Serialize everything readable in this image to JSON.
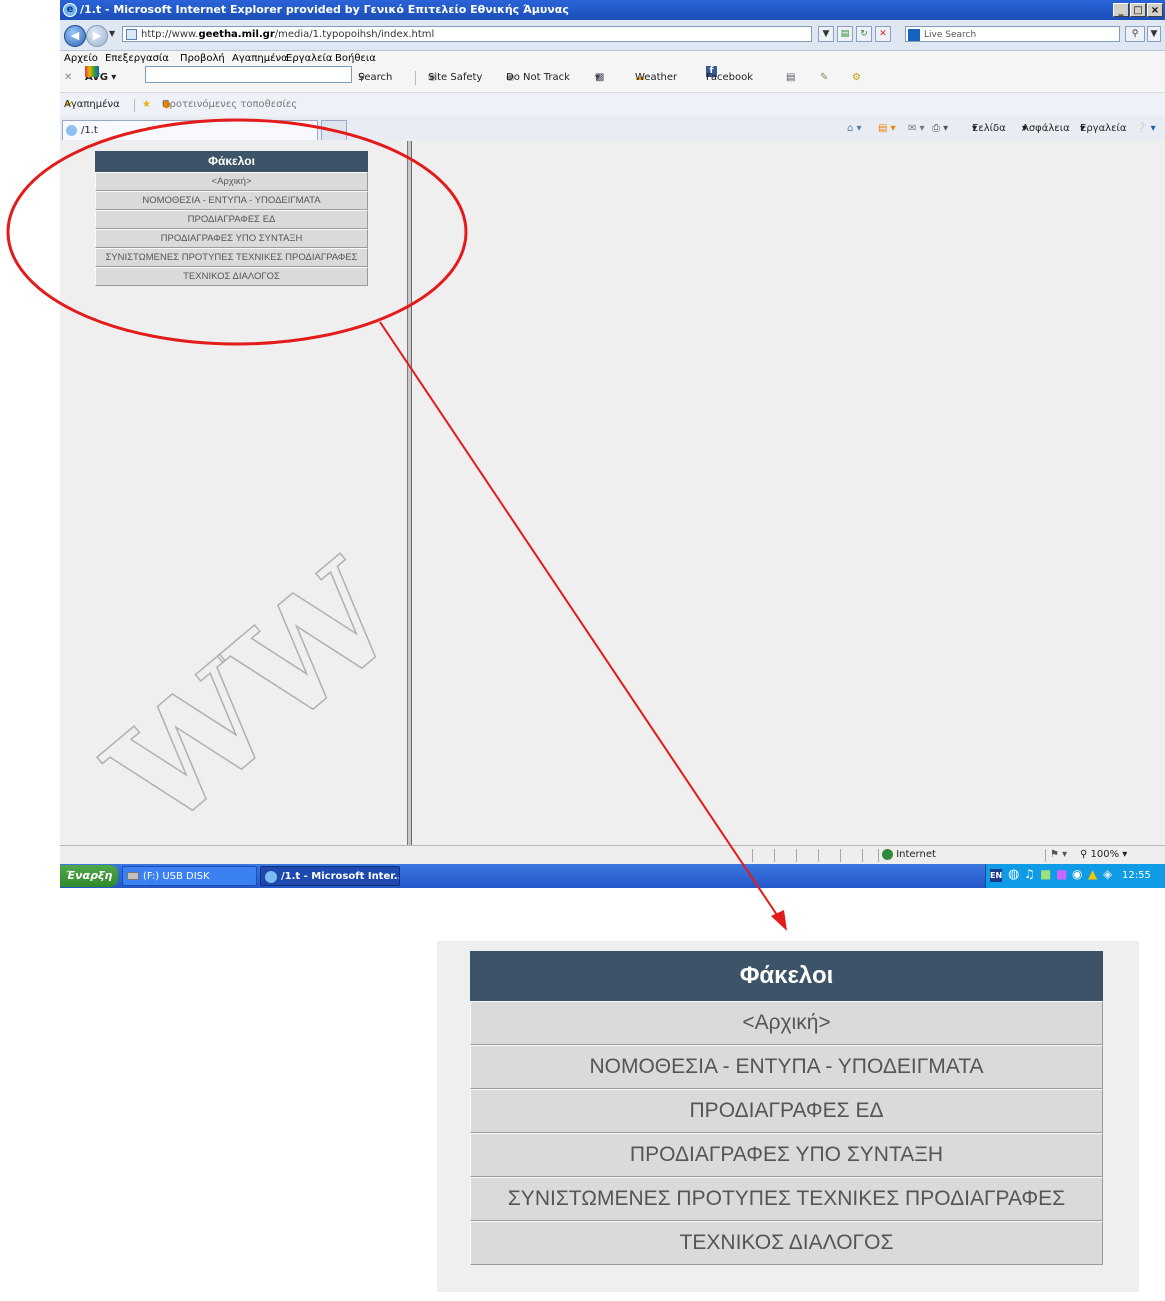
{
  "window": {
    "title": "/1.t - Microsoft Internet Explorer provided by Γενικό Επιτελείο Εθνικής Άμυνας",
    "buttons": [
      "_",
      "□",
      "×"
    ]
  },
  "address_bar": {
    "url_prefix": "http://www.",
    "url_domain": "geetha.mil.gr",
    "url_path": "/media/1.typopoihsh/index.html",
    "search_placeholder": "Live Search"
  },
  "menu": [
    "Αρχείο",
    "Επεξεργασία",
    "Προβολή",
    "Αγαπημένα",
    "Εργαλεία",
    "Βοήθεια"
  ],
  "avg_toolbar": {
    "brand": "AVG",
    "search_label": "Search",
    "items": [
      "Site Safety",
      "Do Not Track",
      "Weather",
      "Facebook"
    ]
  },
  "favorites_bar": {
    "favorites": "Αγαπημένα",
    "suggested": "Προτεινόμενες τοποθεσίες"
  },
  "tab": {
    "label": "/1.t"
  },
  "command_bar": [
    "Σελίδα",
    "Ασφάλεια",
    "Εργαλεία"
  ],
  "folders": {
    "header": "Φάκελοι",
    "items": [
      "<Αρχική>",
      "ΝΟΜΟΘΕΣΙΑ - ΕΝΤΥΠΑ - ΥΠΟΔΕΙΓΜΑΤΑ",
      "ΠΡΟΔΙΑΓΡΑΦΕΣ ΕΔ",
      "ΠΡΟΔΙΑΓΡΑΦΕΣ ΥΠΟ ΣΥΝΤΑΞΗ",
      "ΣΥΝΙΣΤΩΜΕΝΕΣ ΠΡΟΤΥΠΕΣ ΤΕΧΝΙΚΕΣ ΠΡΟΔΙΑΓΡΑΦΕΣ",
      "ΤΕΧΝΙΚΟΣ ΔΙΑΛΟΓΟΣ"
    ]
  },
  "status_bar": {
    "zone": "Internet",
    "zoom": "100%"
  },
  "taskbar": {
    "start": "Έναρξη",
    "items": [
      "(F:) USB DISK",
      "/1.t - Microsoft Inter..."
    ],
    "lang": "EN",
    "clock": "12:55 μμ"
  },
  "annotation": {
    "color": "#e41b1b"
  }
}
